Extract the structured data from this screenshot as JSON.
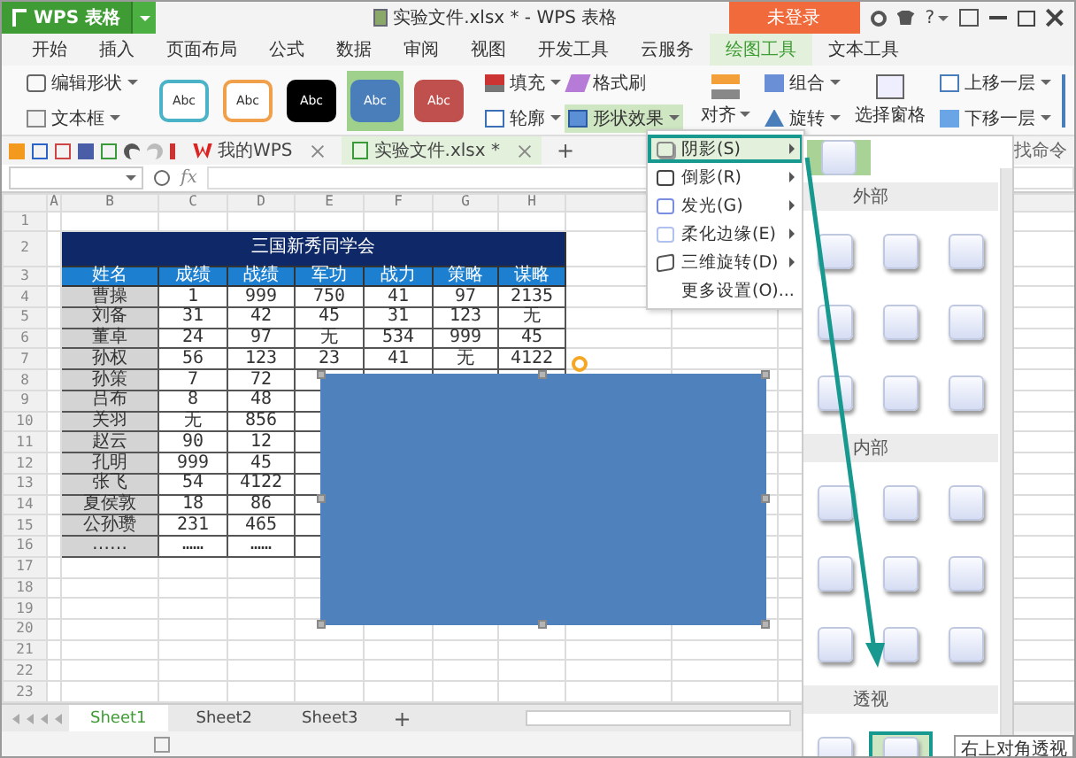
{
  "title_bar": {
    "app_button": "WPS 表格",
    "title": "实验文件.xlsx * - WPS 表格",
    "login_button": "未登录",
    "help": "?"
  },
  "menu_tabs": [
    {
      "label": "开始",
      "selected": false
    },
    {
      "label": "插入",
      "selected": false
    },
    {
      "label": "页面布局",
      "selected": false
    },
    {
      "label": "公式",
      "selected": false
    },
    {
      "label": "数据",
      "selected": false
    },
    {
      "label": "审阅",
      "selected": false
    },
    {
      "label": "视图",
      "selected": false
    },
    {
      "label": "开发工具",
      "selected": false
    },
    {
      "label": "云服务",
      "selected": false
    },
    {
      "label": "绘图工具",
      "selected": true
    },
    {
      "label": "文本工具",
      "selected": false
    }
  ],
  "ribbon": {
    "shape_tools": [
      {
        "label": "编辑形状",
        "kind": "edit"
      },
      {
        "label": "文本框",
        "kind": "textbox"
      }
    ],
    "styles": [
      {
        "label": "Abc",
        "kind": "outline",
        "color": "#4bb3c8",
        "selected": false
      },
      {
        "label": "Abc",
        "kind": "outline",
        "color": "#f0a04b",
        "selected": false
      },
      {
        "label": "Abc",
        "kind": "filled",
        "color": "#000000",
        "selected": false
      },
      {
        "label": "Abc",
        "kind": "filled",
        "color": "#4a7ebb",
        "selected": true
      },
      {
        "label": "Abc",
        "kind": "filled",
        "color": "#c0504d",
        "selected": false
      }
    ],
    "format": [
      {
        "label": "填充",
        "kind": "fill",
        "dropdown": true,
        "expanded": false
      },
      {
        "label": "格式刷",
        "kind": "brush",
        "dropdown": false,
        "expanded": false
      },
      {
        "label": "轮廓",
        "kind": "outline",
        "dropdown": true,
        "expanded": false
      },
      {
        "label": "形状效果",
        "kind": "effects",
        "dropdown": true,
        "expanded": true
      }
    ],
    "arrange": [
      {
        "label": "对齐",
        "kind": "align",
        "dropdown": true
      },
      {
        "label": "组合",
        "kind": "group",
        "dropdown": true
      },
      {
        "label": "旋转",
        "kind": "rotate",
        "dropdown": true
      },
      {
        "label": "选择窗格",
        "kind": "pane",
        "dropdown": false
      },
      {
        "label": "上移一层",
        "kind": "up",
        "dropdown": true
      },
      {
        "label": "下移一层",
        "kind": "down",
        "dropdown": true
      }
    ]
  },
  "doc_tabs": [
    {
      "label": "我的WPS",
      "kind": "home",
      "selected": false
    },
    {
      "label": "实验文件.xlsx *",
      "kind": "sheet",
      "selected": true
    }
  ],
  "new_tab": "+",
  "command_search": "找命令",
  "formula_bar": {
    "fx": "fx"
  },
  "sheet": {
    "columns": [
      "A",
      "B",
      "C",
      "D",
      "E",
      "F",
      "G",
      "H"
    ],
    "row_numbers": [
      "1",
      "2",
      "3",
      "4",
      "5",
      "6",
      "7",
      "8",
      "9",
      "10",
      "11",
      "12",
      "13",
      "14",
      "15",
      "16",
      "17",
      "18",
      "19",
      "20",
      "21",
      "22",
      "23"
    ],
    "title": "三国新秀同学会",
    "headers": [
      "姓名",
      "成绩",
      "战绩",
      "军功",
      "战力",
      "策略",
      "谋略"
    ],
    "rows": [
      [
        "",
        "曹操",
        "1",
        "999",
        "750",
        "41",
        "97",
        "2135"
      ],
      [
        "",
        "刘备",
        "31",
        "42",
        "45",
        "31",
        "123",
        "无"
      ],
      [
        "",
        "董卓",
        "24",
        "97",
        "无",
        "534",
        "999",
        "45"
      ],
      [
        "",
        "孙权",
        "56",
        "123",
        "23",
        "41",
        "无",
        "4122"
      ],
      [
        "",
        "孙策",
        "7",
        "72"
      ],
      [
        "",
        "吕布",
        "8",
        "48"
      ],
      [
        "",
        "关羽",
        "无",
        "856"
      ],
      [
        "",
        "赵云",
        "90",
        "12"
      ],
      [
        "",
        "孔明",
        "999",
        "45"
      ],
      [
        "",
        "张飞",
        "54",
        "4122"
      ],
      [
        "",
        "夏侯敦",
        "18",
        "86"
      ],
      [
        "",
        "公孙瓒",
        "231",
        "465"
      ],
      [
        "",
        "……",
        "……",
        "……"
      ]
    ]
  },
  "sheet_tabs": [
    {
      "label": "Sheet1",
      "selected": true
    },
    {
      "label": "Sheet2",
      "selected": false
    },
    {
      "label": "Sheet3",
      "selected": false
    }
  ],
  "add_sheet": "+",
  "effects_menu": [
    {
      "label": "阴影(S)",
      "kind": "shadow",
      "selected": true,
      "submenu": true
    },
    {
      "label": "倒影(R)",
      "kind": "reflection",
      "selected": false,
      "submenu": true
    },
    {
      "label": "发光(G)",
      "kind": "glow",
      "selected": false,
      "submenu": true
    },
    {
      "label": "柔化边缘(E)",
      "kind": "soft",
      "selected": false,
      "submenu": true
    },
    {
      "label": "三维旋转(D)",
      "kind": "rotation",
      "selected": false,
      "submenu": true
    },
    {
      "label": "更多设置(O)...",
      "kind": "more",
      "selected": false,
      "submenu": false
    }
  ],
  "shadow_gallery": {
    "preview_selected": true,
    "sections": [
      {
        "title": "外部",
        "items": [
          {
            "selected": false
          },
          {
            "selected": false
          },
          {
            "selected": false
          },
          {
            "selected": false
          },
          {
            "selected": false
          },
          {
            "selected": false
          },
          {
            "selected": false
          },
          {
            "selected": false
          },
          {
            "selected": false
          }
        ]
      },
      {
        "title": "内部",
        "items": [
          {
            "selected": false
          },
          {
            "selected": false
          },
          {
            "selected": false
          },
          {
            "selected": false
          },
          {
            "selected": false
          },
          {
            "selected": false
          },
          {
            "selected": false
          },
          {
            "selected": false
          },
          {
            "selected": false
          }
        ]
      },
      {
        "title": "透视",
        "items": [
          {
            "selected": false
          },
          {
            "selected": true
          }
        ]
      }
    ],
    "tooltip": "右上对角透视"
  }
}
